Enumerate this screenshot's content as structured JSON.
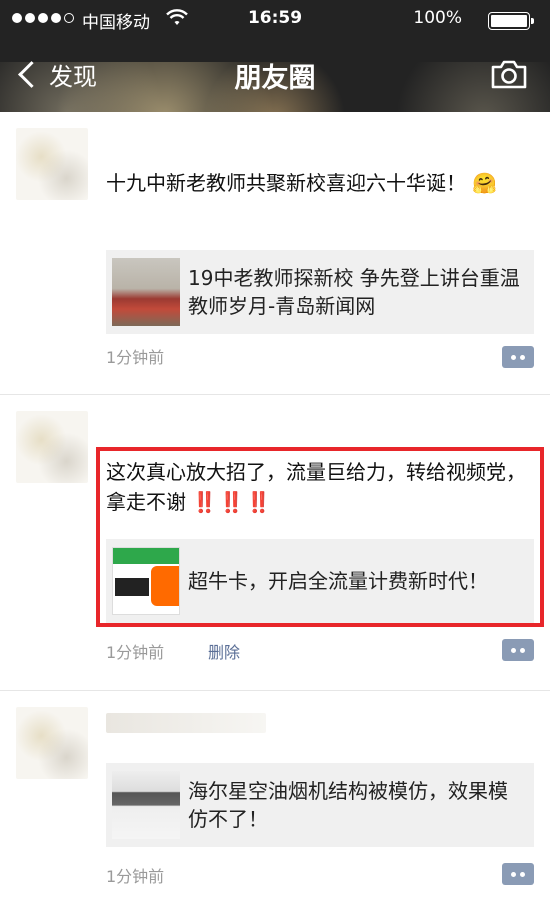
{
  "status_bar": {
    "carrier": "中国移动",
    "time": "16:59",
    "battery": "100%",
    "battery_level": 1.0
  },
  "nav": {
    "back_label": "发现",
    "title": "朋友圈"
  },
  "posts": [
    {
      "text": "十九中新老教师共聚新校喜迎六十华诞！",
      "emoji": "🤗",
      "link_title": "19中老教师探新校 争先登上讲台重温教师岁月-青岛新闻网",
      "time": "1分钟前"
    },
    {
      "text": "这次真心放大招了，流量巨给力，转给视频党，拿走不谢",
      "bangs": "‼️‼️‼️",
      "link_title": "超牛卡，开启全流量计费新时代！",
      "time": "1分钟前",
      "delete_label": "删除"
    },
    {
      "link_title": "海尔星空油烟机结构被模仿，效果模仿不了！",
      "time": "1分钟前"
    }
  ],
  "colors": {
    "header_bg": "#232323",
    "highlight": "#e8262a",
    "link_blue": "#5a6e96",
    "comment_btn": "#8a9bb5"
  }
}
